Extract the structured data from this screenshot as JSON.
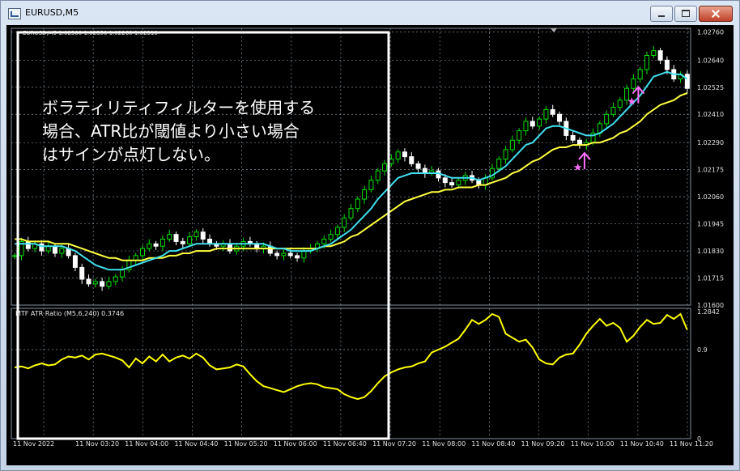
{
  "window": {
    "title": "EURUSD,M5"
  },
  "info_line": "EURUSD,M5  1.02300 1.02350 1.02260 1.02310",
  "annotation": "ボラティリティフィルターを使用する\n場合、ATR比が閾値より小さい場合\nはサインが点灯しない。",
  "subwindow": {
    "label": "MTF ATR Ratio  (M5,6,240) 0.3746",
    "scale_top": "1.2842",
    "scale_mid": "0.9",
    "scale_bottom": "0"
  },
  "colors": {
    "bull": "#00e000",
    "bear": "#ffffff",
    "ma_fast": "#40e0f0",
    "ma_slow": "#ffff40",
    "ratio": "#ffff00",
    "arrow": "#ff70ff",
    "grid": "#8090a0"
  },
  "icons": {
    "signal_arrow": "up-arrow-icon",
    "signal_star": "star-icon"
  },
  "chart_data": [
    {
      "type": "candlestick",
      "title": "EURUSD,M5",
      "y_ticks": [
        1.0276,
        1.0264,
        1.02525,
        1.0241,
        1.0229,
        1.02175,
        1.0206,
        1.01945,
        1.0183,
        1.01715,
        1.016
      ],
      "ylim": [
        1.016,
        1.02775
      ],
      "x_ticks": [
        "11 Nov 2022",
        "11 Nov 03:20",
        "11 Nov 04:00",
        "11 Nov 04:40",
        "11 Nov 05:20",
        "11 Nov 06:00",
        "11 Nov 06:40",
        "11 Nov 07:20",
        "11 Nov 08:00",
        "11 Nov 08:40",
        "11 Nov 09:20",
        "11 Nov 10:00",
        "11 Nov 10:40",
        "11 Nov 11:20"
      ],
      "close": [
        1.0181,
        1.0187,
        1.0184,
        1.0186,
        1.0183,
        1.0185,
        1.0182,
        1.0184,
        1.0181,
        1.0176,
        1.0171,
        1.0169,
        1.017,
        1.0168,
        1.017,
        1.0172,
        1.0175,
        1.0179,
        1.0181,
        1.0184,
        1.0186,
        1.0185,
        1.0188,
        1.019,
        1.0187,
        1.0186,
        1.0189,
        1.0191,
        1.0188,
        1.0186,
        1.0185,
        1.0186,
        1.0183,
        1.0185,
        1.0187,
        1.0186,
        1.0184,
        1.0185,
        1.0182,
        1.0181,
        1.0182,
        1.0181,
        1.018,
        1.0183,
        1.0184,
        1.0186,
        1.0188,
        1.019,
        1.0193,
        1.0197,
        1.0201,
        1.0205,
        1.0209,
        1.0213,
        1.0217,
        1.022,
        1.0222,
        1.0225,
        1.0223,
        1.022,
        1.0218,
        1.0216,
        1.0217,
        1.0214,
        1.0212,
        1.0211,
        1.0213,
        1.0215,
        1.0213,
        1.0211,
        1.0214,
        1.0218,
        1.0222,
        1.0226,
        1.023,
        1.0234,
        1.0238,
        1.0236,
        1.0239,
        1.0243,
        1.0241,
        1.0238,
        1.0232,
        1.023,
        1.0228,
        1.0229,
        1.0233,
        1.0237,
        1.0241,
        1.0244,
        1.0247,
        1.0252,
        1.0256,
        1.026,
        1.0266,
        1.0268,
        1.0264,
        1.026,
        1.0256,
        1.0258,
        1.0252
      ],
      "series": [
        {
          "name": "MA fast",
          "values": [
            1.0186,
            1.0186,
            1.0186,
            1.0186,
            1.0185,
            1.0185,
            1.0185,
            1.0185,
            1.0184,
            1.0183,
            1.0181,
            1.0179,
            1.0177,
            1.0176,
            1.0175,
            1.0175,
            1.0175,
            1.0176,
            1.0177,
            1.0178,
            1.0179,
            1.018,
            1.0181,
            1.0183,
            1.0183,
            1.0184,
            1.0185,
            1.0186,
            1.0186,
            1.0186,
            1.0186,
            1.0186,
            1.0186,
            1.0186,
            1.0186,
            1.0186,
            1.0186,
            1.0186,
            1.0185,
            1.0184,
            1.0184,
            1.0183,
            1.0183,
            1.0183,
            1.0183,
            1.0184,
            1.0185,
            1.0186,
            1.0188,
            1.019,
            1.0192,
            1.0195,
            1.0198,
            1.0201,
            1.0205,
            1.0208,
            1.0211,
            1.0214,
            1.0215,
            1.0216,
            1.0216,
            1.0216,
            1.0216,
            1.0216,
            1.0215,
            1.0214,
            1.0214,
            1.0214,
            1.0214,
            1.0213,
            1.0214,
            1.0215,
            1.0217,
            1.0219,
            1.0222,
            1.0225,
            1.0228,
            1.0229,
            1.0232,
            1.0235,
            1.0236,
            1.0236,
            1.0235,
            1.0234,
            1.0233,
            1.0232,
            1.0232,
            1.0233,
            1.0235,
            1.0237,
            1.024,
            1.0243,
            1.0246,
            1.0249,
            1.0253,
            1.0257,
            1.0258,
            1.0259,
            1.0258,
            1.0258,
            1.0256
          ]
        },
        {
          "name": "MA slow",
          "values": [
            1.0188,
            1.0188,
            1.0187,
            1.0187,
            1.0187,
            1.0187,
            1.0186,
            1.0186,
            1.0186,
            1.0185,
            1.0184,
            1.0183,
            1.0182,
            1.0181,
            1.018,
            1.018,
            1.0179,
            1.0179,
            1.0179,
            1.0179,
            1.018,
            1.018,
            1.018,
            1.0181,
            1.0181,
            1.0182,
            1.0182,
            1.0183,
            1.0183,
            1.0183,
            1.0184,
            1.0184,
            1.0184,
            1.0184,
            1.0184,
            1.0184,
            1.0184,
            1.0184,
            1.0184,
            1.0184,
            1.0184,
            1.0184,
            1.0184,
            1.0184,
            1.0184,
            1.0184,
            1.0185,
            1.0185,
            1.0186,
            1.0187,
            1.0189,
            1.019,
            1.0192,
            1.0194,
            1.0196,
            1.0198,
            1.02,
            1.0202,
            1.0204,
            1.0205,
            1.0206,
            1.0207,
            1.0208,
            1.0208,
            1.0209,
            1.0209,
            1.021,
            1.021,
            1.021,
            1.0211,
            1.0211,
            1.0212,
            1.0213,
            1.0214,
            1.0216,
            1.0217,
            1.0219,
            1.0221,
            1.0222,
            1.0224,
            1.0226,
            1.0227,
            1.0227,
            1.0228,
            1.0228,
            1.0228,
            1.0229,
            1.0229,
            1.023,
            1.0231,
            1.0233,
            1.0234,
            1.0236,
            1.0238,
            1.0241,
            1.0243,
            1.0245,
            1.0246,
            1.0247,
            1.0249,
            1.025
          ]
        },
        {
          "name": "MTF ATR Ratio",
          "values": [
            0.72,
            0.73,
            0.71,
            0.74,
            0.76,
            0.74,
            0.75,
            0.8,
            0.83,
            0.82,
            0.84,
            0.8,
            0.85,
            0.86,
            0.84,
            0.82,
            0.79,
            0.72,
            0.81,
            0.76,
            0.83,
            0.78,
            0.85,
            0.78,
            0.82,
            0.84,
            0.81,
            0.86,
            0.82,
            0.74,
            0.7,
            0.71,
            0.72,
            0.75,
            0.73,
            0.65,
            0.58,
            0.53,
            0.51,
            0.49,
            0.47,
            0.5,
            0.53,
            0.55,
            0.56,
            0.55,
            0.52,
            0.51,
            0.5,
            0.45,
            0.42,
            0.4,
            0.42,
            0.48,
            0.56,
            0.63,
            0.67,
            0.7,
            0.72,
            0.73,
            0.76,
            0.78,
            0.87,
            0.9,
            0.93,
            0.97,
            1.01,
            1.1,
            1.2,
            1.16,
            1.2,
            1.26,
            1.23,
            1.06,
            1.02,
            0.98,
            1.0,
            0.92,
            0.8,
            0.76,
            0.75,
            0.82,
            0.85,
            0.86,
            0.95,
            1.06,
            1.14,
            1.21,
            1.14,
            1.17,
            1.12,
            0.98,
            1.04,
            1.13,
            1.2,
            1.16,
            1.17,
            1.25,
            1.21,
            1.26,
            1.1
          ]
        }
      ],
      "signals": [
        {
          "index": 84,
          "type": "buy"
        },
        {
          "index": 92,
          "type": "buy"
        }
      ],
      "grid": true
    }
  ]
}
